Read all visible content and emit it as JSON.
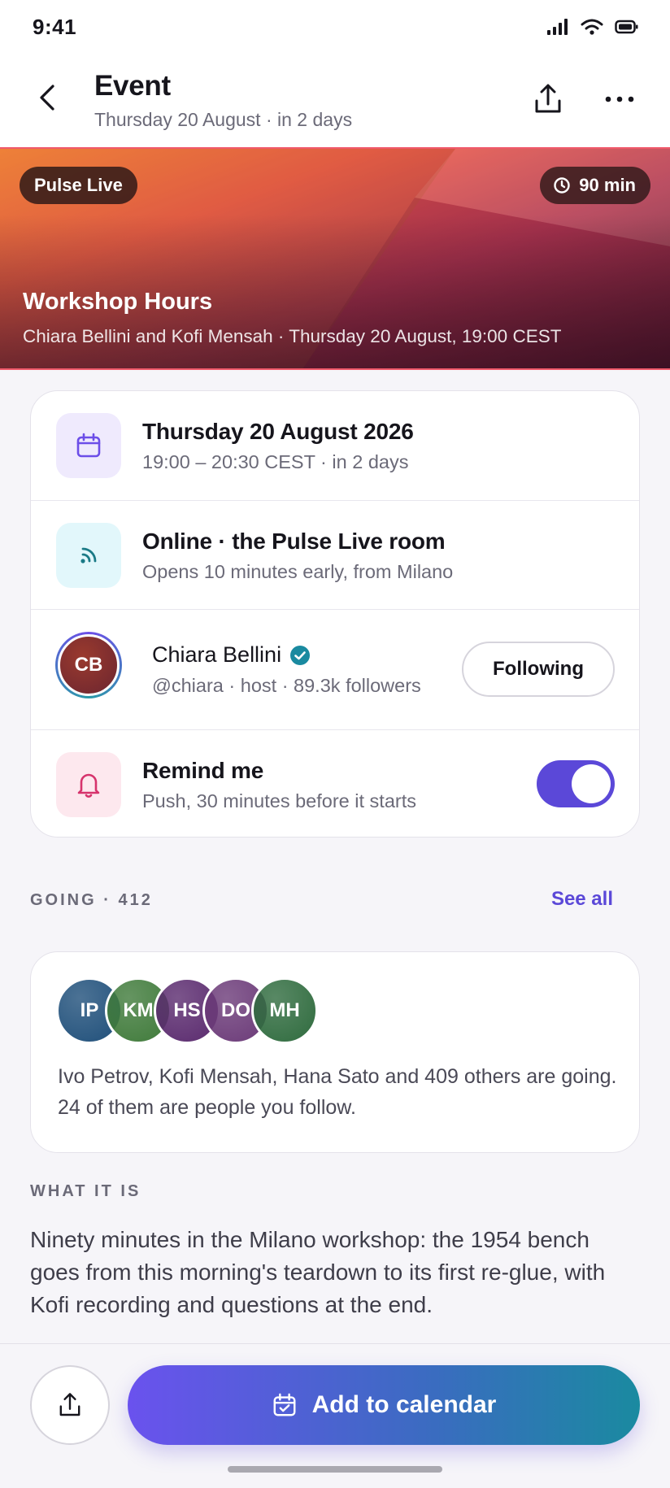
{
  "status": {
    "time": "9:41"
  },
  "nav": {
    "title": "Event",
    "subtitle": "Thursday 20 August · in 2 days"
  },
  "hero": {
    "badge": "Pulse Live",
    "duration": "90 min",
    "title": "Workshop Hours",
    "meta": "Chiara Bellini and Kofi Mensah · Thursday 20 August, 19:00 CEST"
  },
  "details": {
    "date": {
      "title": "Thursday 20 August 2026",
      "sub": "19:00 – 20:30 CEST · in 2 days"
    },
    "location": {
      "title": "Online · the Pulse Live room",
      "sub": "Opens 10 minutes early, from Milano"
    },
    "host": {
      "initials": "CB",
      "name": "Chiara Bellini",
      "meta": "@chiara · host · 89.3k followers",
      "follow_label": "Following"
    },
    "reminder": {
      "title": "Remind me",
      "sub": "Push, 30 minutes before it starts",
      "enabled": true
    }
  },
  "going": {
    "label": "GOING · 412",
    "see_all": "See all",
    "avatars": [
      {
        "initials": "IP",
        "color": "#1f4f7a"
      },
      {
        "initials": "KM",
        "color": "#3f7a3a"
      },
      {
        "initials": "HS",
        "color": "#5a2a6e"
      },
      {
        "initials": "DO",
        "color": "#6b3a78"
      },
      {
        "initials": "MH",
        "color": "#2f6b3e"
      }
    ],
    "text": "Ivo Petrov, Kofi Mensah, Hana Sato and 409 others are going. 24 of them are people you follow."
  },
  "about": {
    "label": "WHAT IT IS",
    "text": "Ninety minutes in the Milano workshop: the 1954 bench goes from this morning's teardown to its first re-glue, with Kofi recording and questions at the end."
  },
  "bottom": {
    "cta": "Add to calendar"
  },
  "colors": {
    "accent": "#5b48d8",
    "teal": "#1a8aa0"
  }
}
